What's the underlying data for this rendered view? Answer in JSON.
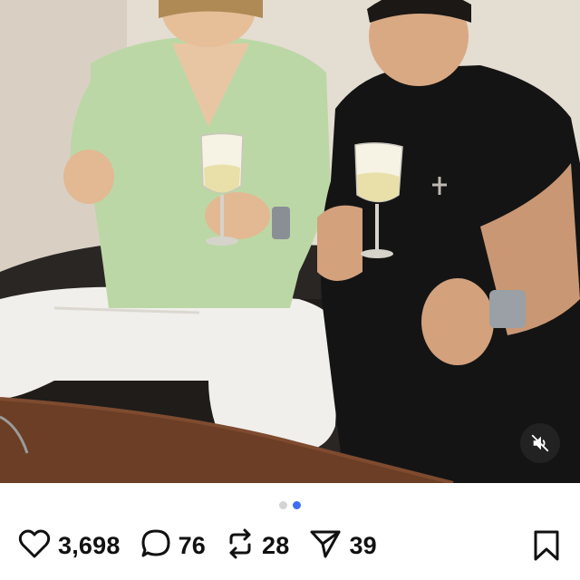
{
  "post": {
    "media": {
      "icon": "muted-speaker-icon",
      "carousel": {
        "total": 2,
        "active_index": 1
      }
    },
    "actions": {
      "likes": {
        "icon": "heart-icon",
        "count": "3,698"
      },
      "comments": {
        "icon": "comment-bubble-icon",
        "count": "76"
      },
      "reposts": {
        "icon": "repost-arrows-icon",
        "count": "28"
      },
      "shares": {
        "icon": "send-arrow-icon",
        "count": "39"
      },
      "bookmark": {
        "icon": "bookmark-icon"
      }
    }
  },
  "colors": {
    "active_dot": "#3f6df6",
    "inactive_dot": "#d4d4d4",
    "text": "#111111"
  }
}
